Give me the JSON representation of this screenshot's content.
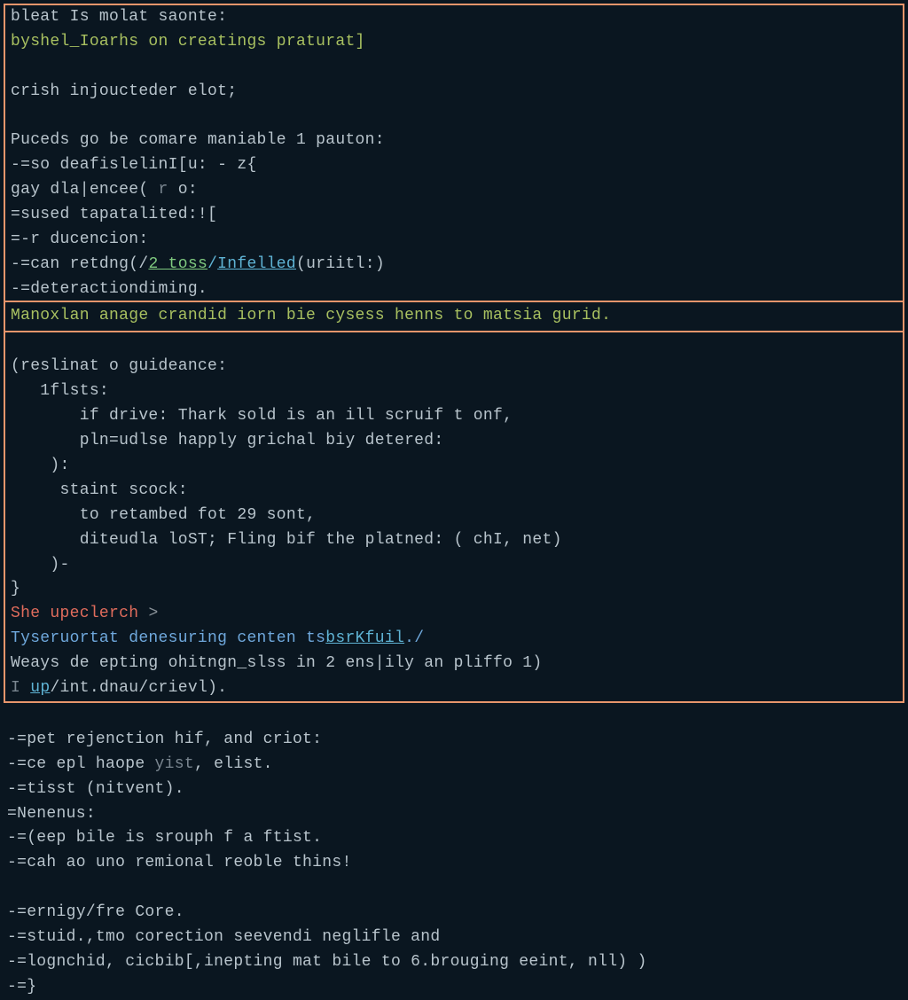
{
  "lines": {
    "l01a": "bleat Is molat saonte:",
    "l02a": "byshel_Ioarhs on creatings praturat]",
    "l03": "",
    "l04": "crish injoucteder elot;",
    "l05": "",
    "l06a": "Puceds go be comare maniable 1 pauton:",
    "l07a": "-=so deafislelinI[u: - z{",
    "l07b_pre": "gay dla|encee( ",
    "l07b_r": "r",
    "l07b_post": " o:",
    "l08a": "=sused tapatalited:![",
    "l09a": "=-r ducencion:",
    "l10_pre": "-=can retdng(/",
    "l10_link1": "2 toss",
    "l10_mid": "/",
    "l10_link2": "Infelled",
    "l10_post": "(uriitl:)",
    "l11a": "-=deteractiondiming.",
    "highlight": "Manoxlan anage crandid iorn bie cysess henns to matsia gurid.",
    "l12": "",
    "l13": "(reslinat o guideance:",
    "l14": "   1flsts:",
    "l15": "       if drive: Thark sold is an ill scruif t onf,",
    "l16": "       pln=udlse happly grichal biy detered:",
    "l17": "    ):",
    "l18": "     staint scock:",
    "l19": "       to retambed fot 29 sont,",
    "l20": "       diteudla loST; Fling bif the platned: ( chI, net)",
    "l21": "    )-",
    "l22": "}",
    "l23_pre": "She upeclerch ",
    "l23_gt": ">",
    "l24_pre": "Tyseruortat denesuring centen ts",
    "l24_link": "bsrKfuil",
    "l24_post": "./",
    "l25_pre": "Weays de epting ohitngn_slss in 2 ens|ily an pliffo 1)",
    "l26_pre": "I ",
    "l26_link": "up",
    "l26_post": "/int.dnau/crievl).",
    "l27": "",
    "l28": "-=pet rejenction hif, and criot:",
    "l29_pre": "-=ce epl haope ",
    "l29_y": "yist",
    "l29_post": ", elist.",
    "l30": "-=tisst (nitvent).",
    "l31": "=Nenenus:",
    "l32": "-=(eep bile is srouph f a ftist.",
    "l33": "-=cah ao uno remional reoble thins!",
    "l34": "",
    "l35": "-=ernigy/fre Core.",
    "l36": "-=stuid.,tmo corection seevendi neglifle and",
    "l37": "-=lognchid, cicbib[,inepting mat bile to 6.brouging eeint, nll) )",
    "l38": "-=}"
  }
}
